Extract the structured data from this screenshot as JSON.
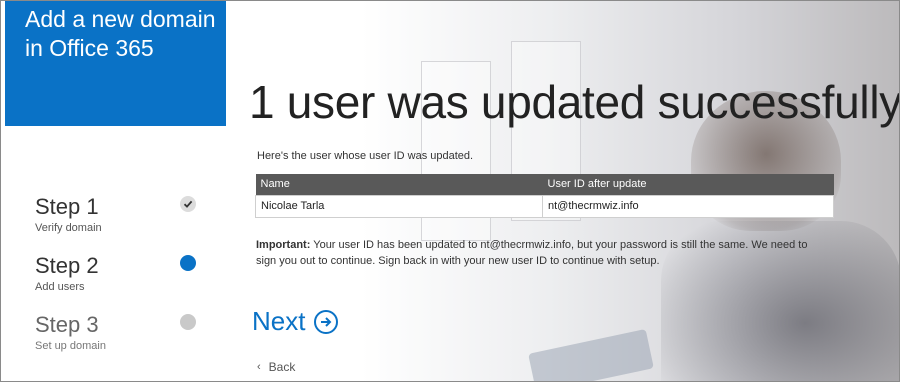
{
  "brand": {
    "title_line1": "Add a new domain",
    "title_line2": "in Office 365"
  },
  "steps": [
    {
      "title": "Step 1",
      "subtitle": "Verify domain",
      "state": "done",
      "icon": "check-icon"
    },
    {
      "title": "Step 2",
      "subtitle": "Add users",
      "state": "current",
      "icon": "current-dot-icon"
    },
    {
      "title": "Step 3",
      "subtitle": "Set up domain",
      "state": "pending",
      "icon": "pending-dot-icon"
    }
  ],
  "main": {
    "headline": "1 user was updated successfully",
    "intro": "Here's the user whose user ID was updated.",
    "table": {
      "headers": [
        "Name",
        "User ID after update"
      ],
      "rows": [
        [
          "Nicolae Tarla",
          "nt@thecrmwiz.info"
        ]
      ]
    },
    "note_label": "Important:",
    "note_text": " Your user ID has been updated to nt@thecrmwiz.info, but your password is still the same. We need to sign you out to continue. Sign back in with your new user ID to continue with setup.",
    "next_label": "Next",
    "back_label": "Back"
  },
  "colors": {
    "accent": "#0a72c6",
    "table_header": "#595959"
  }
}
